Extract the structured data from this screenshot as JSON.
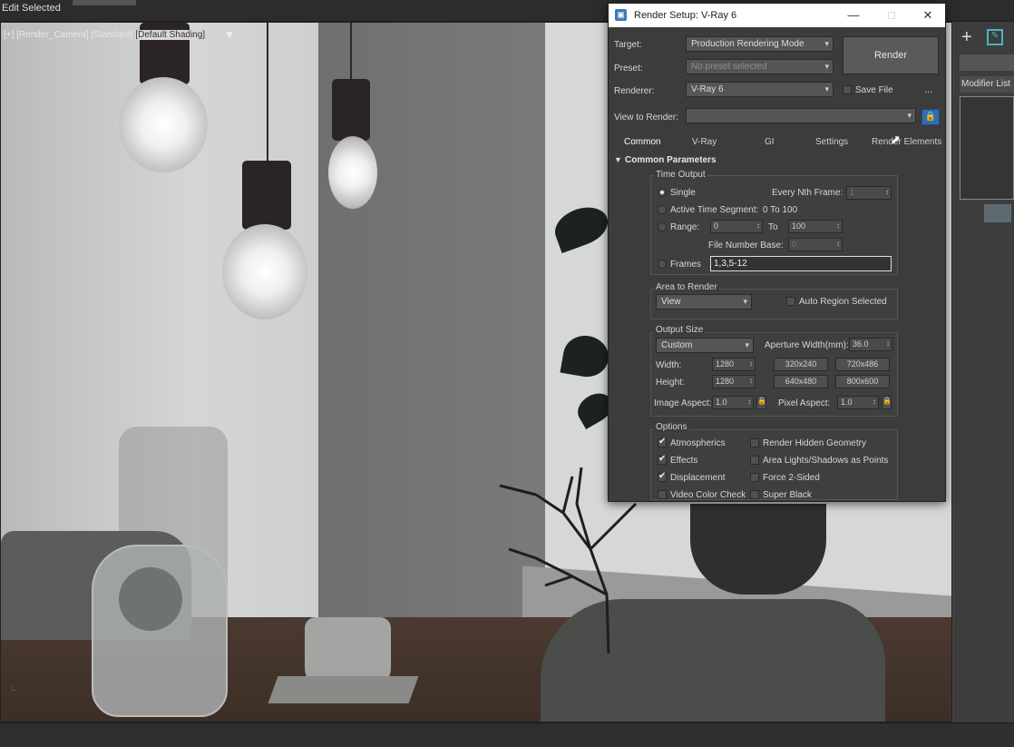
{
  "topbar": {
    "edit_selected": "Edit Selected"
  },
  "viewport": {
    "label_prefix": "[+] [Render_Camera] [Standard] ",
    "label_highlight": "[Default Shading]",
    "filter_icon": "funnel-icon"
  },
  "command_panel": {
    "create_icon": "plus-icon",
    "modify_icon": "modify-icon",
    "modifier_list": "Modifier List"
  },
  "dialog": {
    "title": "Render Setup: V-Ray 6",
    "target_label": "Target:",
    "target_value": "Production Rendering Mode",
    "preset_label": "Preset:",
    "preset_value": "No preset selected",
    "renderer_label": "Renderer:",
    "renderer_value": "V-Ray 6",
    "save_file_label": "Save File",
    "ellipsis": "...",
    "view_label": "View to Render:",
    "view_value": "",
    "render_button": "Render",
    "tabs": [
      "Common",
      "V-Ray",
      "GI",
      "Settings",
      "Render Elements"
    ],
    "rollout_title": "Common Parameters",
    "time_output": {
      "title": "Time Output",
      "single": "Single",
      "every_nth": "Every Nth Frame:",
      "every_nth_value": "1",
      "active_segment": "Active Time Segment:",
      "active_segment_value": "0 To 100",
      "range": "Range:",
      "range_from": "0",
      "range_to_label": "To",
      "range_to": "100",
      "file_number_base": "File Number Base:",
      "file_number_base_value": "0",
      "frames": "Frames",
      "frames_value": "1,3,5-12"
    },
    "area": {
      "title": "Area to Render",
      "value": "View",
      "auto_region": "Auto Region Selected"
    },
    "output_size": {
      "title": "Output Size",
      "preset_value": "Custom",
      "aperture_label": "Aperture Width(mm):",
      "aperture_value": "36.0",
      "width_label": "Width:",
      "width_value": "1280",
      "height_label": "Height:",
      "height_value": "1280",
      "presets": [
        "320x240",
        "720x486",
        "640x480",
        "800x600"
      ],
      "image_aspect_label": "Image Aspect:",
      "image_aspect_value": "1.0",
      "pixel_aspect_label": "Pixel Aspect:",
      "pixel_aspect_value": "1.0"
    },
    "options": {
      "title": "Options",
      "atmospherics": "Atmospherics",
      "effects": "Effects",
      "displacement": "Displacement",
      "video_color_check": "Video Color Check",
      "render_hidden": "Render Hidden Geometry",
      "area_lights": "Area Lights/Shadows as Points",
      "force_2sided": "Force 2-Sided",
      "super_black": "Super Black"
    }
  },
  "colors": {
    "accent_blue": "#2d6fb0",
    "titlebar": "#ffffff",
    "panel_bg": "#3c3c3c"
  }
}
